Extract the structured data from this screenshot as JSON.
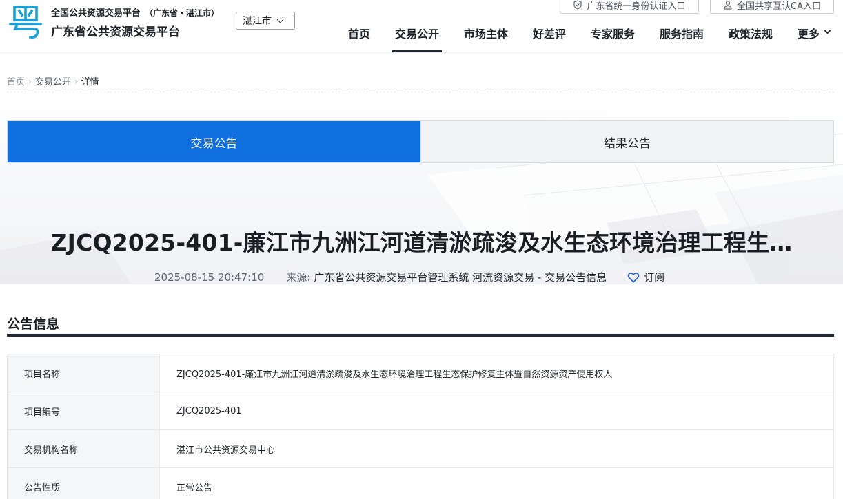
{
  "header": {
    "org_subtitle": "全国公共资源交易平台",
    "org_region": "（广东省・湛江市）",
    "org_title": "广东省公共资源交易平台",
    "city": "湛江市",
    "auth_link": "广东省统一身份认证入口",
    "ca_link": "全国共享互认CA入口",
    "logo_icon": "yue-character-logo-icon",
    "nav": [
      {
        "label": "首页",
        "active": false
      },
      {
        "label": "交易公开",
        "active": true
      },
      {
        "label": "市场主体",
        "active": false
      },
      {
        "label": "好差评",
        "active": false
      },
      {
        "label": "专家服务",
        "active": false
      },
      {
        "label": "服务指南",
        "active": false
      },
      {
        "label": "政策法规",
        "active": false
      },
      {
        "label": "更多",
        "active": false
      }
    ]
  },
  "breadcrumb": [
    "首页",
    "交易公开",
    "详情"
  ],
  "tabs": [
    {
      "label": "交易公告",
      "active": true
    },
    {
      "label": "结果公告",
      "active": false
    }
  ],
  "article": {
    "title": "ZJCQ2025-401-廉江市九洲江河道清淤疏浚及水生态环境治理工程生…",
    "date": "2025-08-15 20:47:10",
    "source_label": "来源:",
    "source_value": "广东省公共资源交易平台管理系统 河流资源交易 - 交易公告信息",
    "subscribe": "订阅"
  },
  "section": {
    "title": "公告信息",
    "rows": [
      {
        "label": "项目名称",
        "value": "ZJCQ2025-401-廉江市九洲江河道清淤疏浚及水生态环境治理工程生态保护修复主体暨自然资源资产使用权人"
      },
      {
        "label": "项目编号",
        "value": "ZJCQ2025-401"
      },
      {
        "label": "交易机构名称",
        "value": "湛江市公共资源交易中心"
      },
      {
        "label": "公告性质",
        "value": "正常公告"
      }
    ]
  },
  "colors": {
    "accent": "#0f6fde",
    "nav_underline": "#1f2937",
    "logo": "#1aa0d8"
  }
}
